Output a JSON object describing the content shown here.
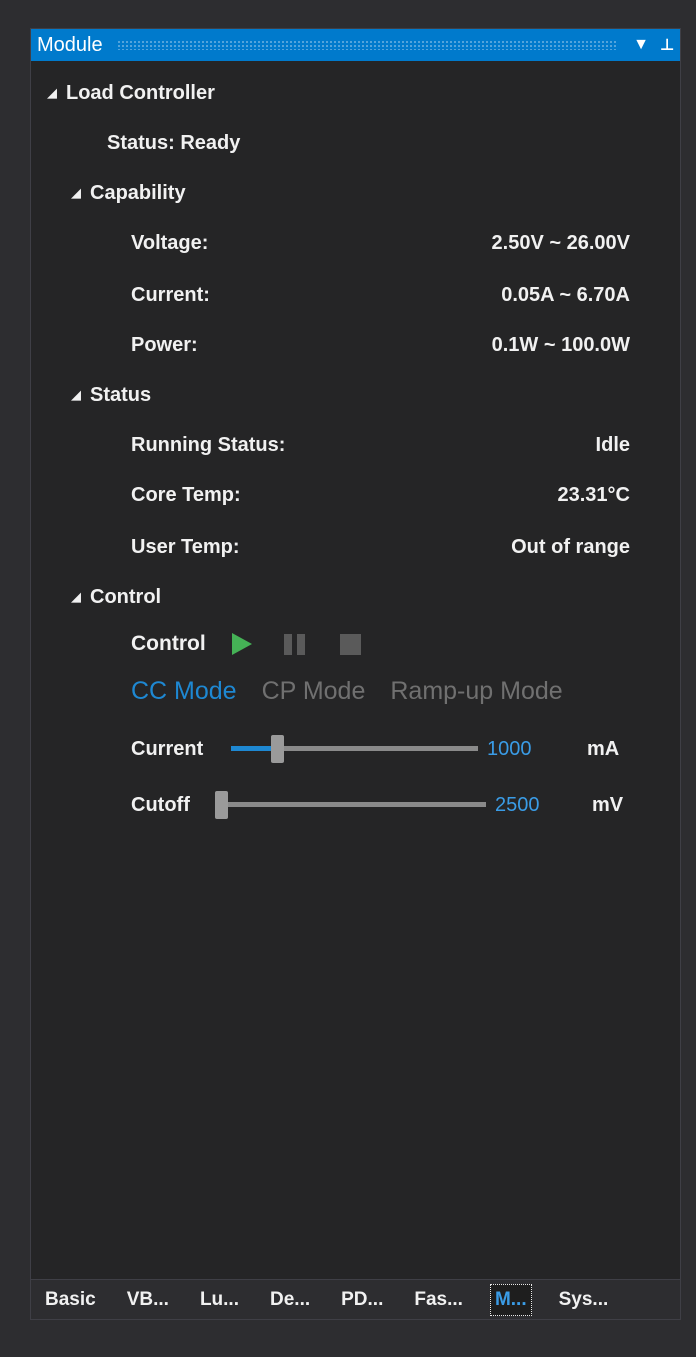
{
  "window": {
    "title": "Module",
    "dropdown_glyph": "▼",
    "pin_glyph": "⊥"
  },
  "tree": {
    "expand_glyph": "◢",
    "root": {
      "label": "Load Controller",
      "status": "Status: Ready"
    },
    "capability": {
      "label": "Capability",
      "rows": [
        {
          "label": "Voltage:",
          "value": "2.50V ~ 26.00V"
        },
        {
          "label": "Current:",
          "value": "0.05A ~ 6.70A"
        },
        {
          "label": "Power:",
          "value": "0.1W ~ 100.0W"
        }
      ]
    },
    "status": {
      "label": "Status",
      "rows": [
        {
          "label": "Running Status:",
          "value": "Idle"
        },
        {
          "label": "Core Temp:",
          "value": "23.31°C"
        },
        {
          "label": "User Temp:",
          "value": "Out of range"
        }
      ]
    },
    "control": {
      "label": "Control",
      "control_label": "Control",
      "modes": [
        "CC Mode",
        "CP Mode",
        "Ramp-up Mode"
      ],
      "active_mode": "CC Mode",
      "sliders": [
        {
          "label": "Current",
          "value": "1000",
          "unit": "mA",
          "fill_fraction": 0.17
        },
        {
          "label": "Cutoff",
          "value": "2500",
          "unit": "mV",
          "fill_fraction": 0.0
        }
      ]
    }
  },
  "tabs": [
    "Basic",
    "VB...",
    "Lu...",
    "De...",
    "PD...",
    "Fas...",
    "M...",
    "Sys..."
  ],
  "active_tab": "M...",
  "colors": {
    "accent": "#007acc",
    "active_mode": "#1e88d2",
    "play": "#45b256",
    "panel_bg": "#252526"
  }
}
